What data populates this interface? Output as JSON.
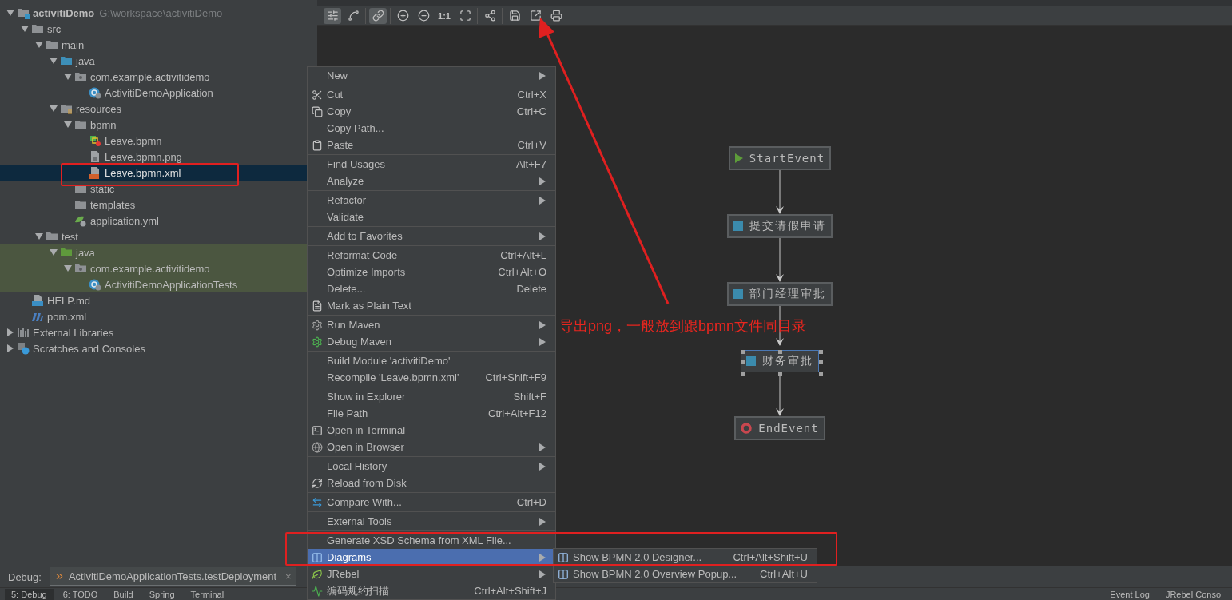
{
  "project_tree": [
    {
      "name": "activitiDemo",
      "path": "G:\\workspace\\activitiDemo",
      "kind": "module",
      "expanded": true,
      "selected": false,
      "tinted": false,
      "children": [
        {
          "name": "src",
          "kind": "folder",
          "expanded": true,
          "selected": false,
          "tinted": false,
          "children": [
            {
              "name": "main",
              "kind": "folder",
              "expanded": true,
              "selected": false,
              "tinted": false,
              "children": [
                {
                  "name": "java",
                  "kind": "source-folder",
                  "expanded": true,
                  "selected": false,
                  "tinted": false,
                  "children": [
                    {
                      "name": "com.example.activitidemo",
                      "kind": "package",
                      "expanded": true,
                      "selected": false,
                      "tinted": false,
                      "children": [
                        {
                          "name": "ActivitiDemoApplication",
                          "kind": "class",
                          "selected": false,
                          "tinted": false
                        }
                      ]
                    }
                  ]
                },
                {
                  "name": "resources",
                  "kind": "resources-folder",
                  "expanded": true,
                  "selected": false,
                  "tinted": false,
                  "children": [
                    {
                      "name": "bpmn",
                      "kind": "folder",
                      "expanded": true,
                      "selected": false,
                      "tinted": false,
                      "children": [
                        {
                          "name": "Leave.bpmn",
                          "kind": "bpmn",
                          "selected": false,
                          "tinted": false
                        },
                        {
                          "name": "Leave.bpmn.png",
                          "kind": "image",
                          "selected": false,
                          "tinted": false
                        },
                        {
                          "name": "Leave.bpmn.xml",
                          "kind": "xml",
                          "selected": true,
                          "tinted": false
                        }
                      ]
                    },
                    {
                      "name": "static",
                      "kind": "folder",
                      "selected": false,
                      "tinted": false
                    },
                    {
                      "name": "templates",
                      "kind": "folder",
                      "selected": false,
                      "tinted": false
                    },
                    {
                      "name": "application.yml",
                      "kind": "yml",
                      "selected": false,
                      "tinted": false
                    }
                  ]
                }
              ]
            },
            {
              "name": "test",
              "kind": "folder",
              "expanded": true,
              "selected": false,
              "tinted": false,
              "children": [
                {
                  "name": "java",
                  "kind": "test-folder",
                  "expanded": true,
                  "selected": false,
                  "tinted": true,
                  "children": [
                    {
                      "name": "com.example.activitidemo",
                      "kind": "package",
                      "expanded": true,
                      "selected": false,
                      "tinted": true,
                      "children": [
                        {
                          "name": "ActivitiDemoApplicationTests",
                          "kind": "class",
                          "selected": false,
                          "tinted": true
                        }
                      ]
                    }
                  ]
                }
              ]
            }
          ]
        },
        {
          "name": "HELP.md",
          "kind": "md",
          "selected": false,
          "tinted": false
        },
        {
          "name": "pom.xml",
          "kind": "maven",
          "selected": false,
          "tinted": false
        }
      ]
    },
    {
      "name": "External Libraries",
      "kind": "libraries",
      "expanded": false,
      "selected": false,
      "tinted": false
    },
    {
      "name": "Scratches and Consoles",
      "kind": "scratches",
      "expanded": false,
      "selected": false,
      "tinted": false
    }
  ],
  "toolbar": {
    "groups": [
      {
        "items": [
          {
            "kind": "sliders",
            "selected": true
          },
          {
            "kind": "connector",
            "selected": false
          }
        ]
      },
      {
        "items": [
          {
            "kind": "link",
            "selected": true
          }
        ]
      },
      {
        "items": [
          {
            "kind": "zoom-in",
            "selected": false
          },
          {
            "kind": "zoom-out",
            "selected": false
          },
          {
            "kind": "actual-size",
            "label": "1:1",
            "selected": false
          },
          {
            "kind": "fit",
            "selected": false
          }
        ]
      },
      {
        "items": [
          {
            "kind": "layout",
            "selected": false
          }
        ]
      },
      {
        "items": [
          {
            "kind": "save",
            "selected": false
          },
          {
            "kind": "export",
            "selected": false
          },
          {
            "kind": "print",
            "selected": false
          }
        ]
      }
    ]
  },
  "diagram": {
    "nodes": [
      {
        "kind": "start",
        "label": "StartEvent",
        "selected": false
      },
      {
        "kind": "task",
        "label": "提交请假申请",
        "selected": false
      },
      {
        "kind": "task",
        "label": "部门经理审批",
        "selected": false
      },
      {
        "kind": "task",
        "label": "财务审批",
        "selected": true
      },
      {
        "kind": "end",
        "label": "EndEvent",
        "selected": false
      }
    ]
  },
  "annotation": {
    "note": "导出png，一般放到跟bpmn文件同目录"
  },
  "context_menu": {
    "groups": [
      {
        "items": [
          {
            "kind": "plain",
            "label": "New",
            "has_submenu": true,
            "selected": false
          }
        ]
      },
      {
        "items": [
          {
            "kind": "cut",
            "label": "Cut",
            "shortcut": "Ctrl+X",
            "has_submenu": false,
            "selected": false
          },
          {
            "kind": "copy",
            "label": "Copy",
            "shortcut": "Ctrl+C",
            "has_submenu": false,
            "selected": false
          },
          {
            "kind": "plain",
            "label": "Copy Path...",
            "has_submenu": false,
            "selected": false
          },
          {
            "kind": "paste",
            "label": "Paste",
            "shortcut": "Ctrl+V",
            "has_submenu": false,
            "selected": false
          }
        ]
      },
      {
        "items": [
          {
            "kind": "plain",
            "label": "Find Usages",
            "shortcut": "Alt+F7",
            "has_submenu": false,
            "selected": false
          },
          {
            "kind": "plain",
            "label": "Analyze",
            "has_submenu": true,
            "selected": false
          }
        ]
      },
      {
        "items": [
          {
            "kind": "plain",
            "label": "Refactor",
            "has_submenu": true,
            "selected": false
          },
          {
            "kind": "plain",
            "label": "Validate",
            "has_submenu": false,
            "selected": false
          }
        ]
      },
      {
        "items": [
          {
            "kind": "plain",
            "label": "Add to Favorites",
            "has_submenu": true,
            "selected": false
          }
        ]
      },
      {
        "items": [
          {
            "kind": "plain",
            "label": "Reformat Code",
            "shortcut": "Ctrl+Alt+L",
            "has_submenu": false,
            "selected": false
          },
          {
            "kind": "plain",
            "label": "Optimize Imports",
            "shortcut": "Ctrl+Alt+O",
            "has_submenu": false,
            "selected": false
          },
          {
            "kind": "plain",
            "label": "Delete...",
            "shortcut": "Delete",
            "has_submenu": false,
            "selected": false
          },
          {
            "kind": "plain-text",
            "label": "Mark as Plain Text",
            "has_submenu": false,
            "selected": false
          }
        ]
      },
      {
        "items": [
          {
            "kind": "gear",
            "label": "Run Maven",
            "has_submenu": true,
            "selected": false
          },
          {
            "kind": "debug-gear",
            "label": "Debug Maven",
            "has_submenu": true,
            "selected": false
          }
        ]
      },
      {
        "items": [
          {
            "kind": "plain",
            "label": "Build Module 'activitiDemo'",
            "has_submenu": false,
            "selected": false
          },
          {
            "kind": "plain",
            "label": "Recompile 'Leave.bpmn.xml'",
            "shortcut": "Ctrl+Shift+F9",
            "has_submenu": false,
            "selected": false
          }
        ]
      },
      {
        "items": [
          {
            "kind": "plain",
            "label": "Show in Explorer",
            "shortcut": "Shift+F",
            "has_submenu": false,
            "selected": false
          },
          {
            "kind": "plain",
            "label": "File Path",
            "shortcut": "Ctrl+Alt+F12",
            "has_submenu": false,
            "selected": false
          },
          {
            "kind": "terminal",
            "label": "Open in Terminal",
            "has_submenu": false,
            "selected": false
          },
          {
            "kind": "globe",
            "label": "Open in Browser",
            "has_submenu": true,
            "selected": false
          }
        ]
      },
      {
        "items": [
          {
            "kind": "plain",
            "label": "Local History",
            "has_submenu": true,
            "selected": false
          },
          {
            "kind": "reload",
            "label": "Reload from Disk",
            "has_submenu": false,
            "selected": false
          }
        ]
      },
      {
        "items": [
          {
            "kind": "compare",
            "label": "Compare With...",
            "shortcut": "Ctrl+D",
            "has_submenu": false,
            "selected": false
          }
        ]
      },
      {
        "items": [
          {
            "kind": "plain",
            "label": "External Tools",
            "has_submenu": true,
            "selected": false
          }
        ]
      },
      {
        "items": [
          {
            "kind": "plain",
            "label": "Generate XSD Schema from XML File...",
            "has_submenu": false,
            "selected": false
          },
          {
            "kind": "diagram",
            "label": "Diagrams",
            "has_submenu": true,
            "selected": true
          },
          {
            "kind": "jrebel",
            "label": "JRebel",
            "has_submenu": true,
            "selected": false
          },
          {
            "kind": "scan",
            "label": "编码规约扫描",
            "shortcut": "Ctrl+Alt+Shift+J",
            "has_submenu": false,
            "selected": false
          }
        ]
      }
    ]
  },
  "diagrams_submenu": {
    "items": [
      {
        "label": "Show BPMN 2.0 Designer...",
        "shortcut": "Ctrl+Alt+Shift+U"
      },
      {
        "label": "Show BPMN 2.0 Overview Popup...",
        "shortcut": "Ctrl+Alt+U"
      }
    ]
  },
  "debug_bar": {
    "label": "Debug:",
    "tab": {
      "title": "ActivitiDemoApplicationTests.testDeployment",
      "close": "×"
    }
  },
  "bottom_bar": {
    "left": [
      {
        "label": "5: Debug",
        "selected": true
      },
      {
        "label": "6: TODO",
        "selected": false
      },
      {
        "label": "Build",
        "selected": false
      },
      {
        "label": "Spring",
        "selected": false
      },
      {
        "label": "Terminal",
        "selected": false
      }
    ],
    "right": [
      {
        "label": "Event Log",
        "selected": false
      },
      {
        "label": "JRebel Conso",
        "selected": false
      }
    ]
  }
}
